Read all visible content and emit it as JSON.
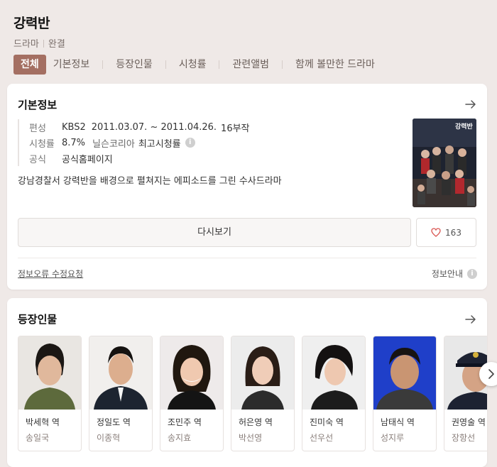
{
  "header": {
    "title": "강력반",
    "genre": "드라마",
    "status": "완결",
    "tabs": [
      "전체",
      "기본정보",
      "등장인물",
      "시청률",
      "관련앨범",
      "함께 볼만한 드라마"
    ]
  },
  "basic_info": {
    "section_title": "기본정보",
    "broadcast_label": "편성",
    "channel": "KBS2",
    "period": "2011.03.07. ~ 2011.04.26.",
    "episodes": "16부작",
    "rating_label": "시청률",
    "rating_value": "8.7%",
    "rating_source": "닐슨코리아",
    "rating_type": "최고시청률",
    "official_label": "공식",
    "official_link": "공식홈페이지",
    "description": "강남경찰서 강력반을 배경으로 펼쳐지는 에피소드를 그린 수사드라마",
    "poster_text": "강력반",
    "watch_label": "다시보기",
    "like_count": "163",
    "report_label": "정보오류 수정요청",
    "guide_label": "정보안내",
    "info_icon": "i"
  },
  "cast": {
    "section_title": "등장인물",
    "members": [
      {
        "role": "박세혁 역",
        "actor": "송일국"
      },
      {
        "role": "정일도 역",
        "actor": "이종혁"
      },
      {
        "role": "조민주 역",
        "actor": "송지효"
      },
      {
        "role": "허은영 역",
        "actor": "박선영"
      },
      {
        "role": "진미숙 역",
        "actor": "선우선"
      },
      {
        "role": "남태식 역",
        "actor": "성지루"
      },
      {
        "role": "권영술 역",
        "actor": "장항선"
      }
    ]
  },
  "colors": {
    "accent": "#a46f62",
    "link_blue": "#3e5fa9",
    "rating_red": "#d0554a",
    "episodes_green": "#2aa55a"
  }
}
